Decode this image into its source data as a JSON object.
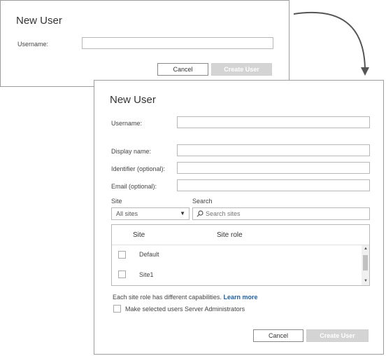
{
  "dialog_small": {
    "title": "New User",
    "username_label": "Username:",
    "username_value": "",
    "cancel_label": "Cancel",
    "create_label": "Create User"
  },
  "dialog_large": {
    "title": "New User",
    "username_label": "Username:",
    "username_value": "",
    "display_name_label": "Display name:",
    "display_name_value": "",
    "identifier_label": "Identifier (optional):",
    "identifier_value": "",
    "email_label": "Email (optional):",
    "email_value": "",
    "site_label": "Site",
    "site_selected": "All sites",
    "search_label": "Search",
    "search_placeholder": "Search sites",
    "table": {
      "columns": [
        "Site",
        "Site role"
      ],
      "rows": [
        {
          "site": "Default",
          "role": "",
          "checked": false
        },
        {
          "site": "Site1",
          "role": "",
          "checked": false
        }
      ]
    },
    "info_text": "Each site role has different capabilities.",
    "learn_more_label": "Learn more",
    "admin_checkbox_label": "Make selected users Server Administrators",
    "admin_checked": false,
    "cancel_label": "Cancel",
    "create_label": "Create User"
  },
  "colors": {
    "link": "#1f5fa0",
    "disabled_button": "#d4d4d4",
    "border": "#b8b8b8",
    "arrow": "#555555"
  }
}
